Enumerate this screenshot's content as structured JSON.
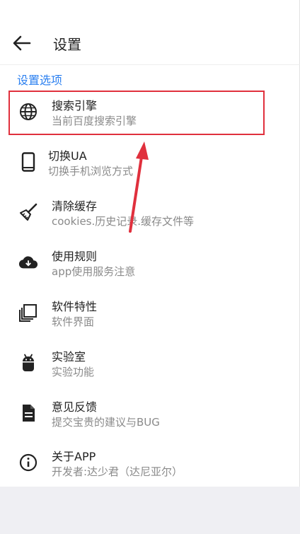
{
  "header": {
    "title": "设置"
  },
  "section_label": "设置选项",
  "items": [
    {
      "title": "搜索引擎",
      "subtitle": "当前百度搜索引擎",
      "icon": "globe-icon"
    },
    {
      "title": "切换UA",
      "subtitle": "切换手机浏览方式",
      "icon": "phone-icon"
    },
    {
      "title": "清除缓存",
      "subtitle": "cookies.历史记录.缓存文件等",
      "icon": "broom-icon"
    },
    {
      "title": "使用规则",
      "subtitle": "app使用服务注意",
      "icon": "cloud-download-icon"
    },
    {
      "title": "软件特性",
      "subtitle": "软件界面",
      "icon": "stack-icon"
    },
    {
      "title": "实验室",
      "subtitle": "实验功能",
      "icon": "android-icon"
    },
    {
      "title": "意见反馈",
      "subtitle": "提交宝贵的建议与BUG",
      "icon": "document-icon"
    },
    {
      "title": "关于APP",
      "subtitle": "开发者:达少君（达尼亚尔）",
      "icon": "info-icon"
    }
  ],
  "colors": {
    "accent": "#2a7ff0",
    "annotation": "#e0303d",
    "background": "#efeff3"
  }
}
